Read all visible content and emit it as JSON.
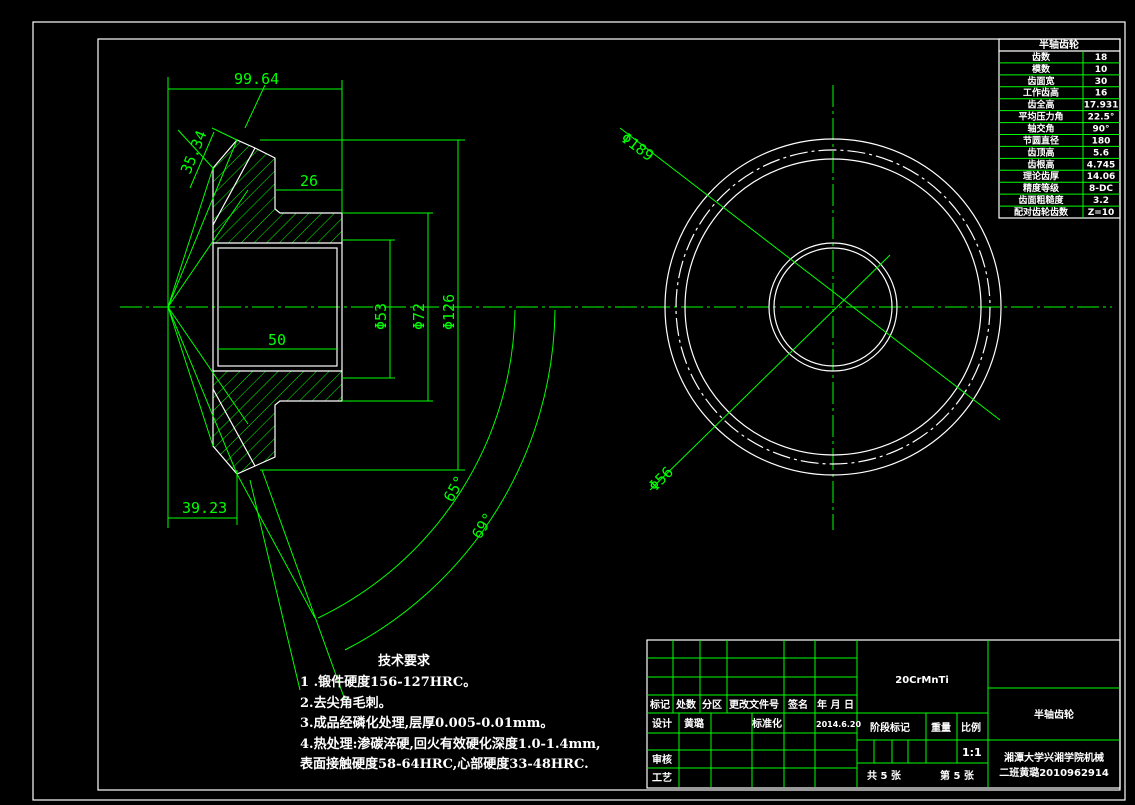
{
  "colors": {
    "background": "#000000",
    "outline": "#ffffff",
    "dimension": "#00ff00"
  },
  "dimensions": {
    "d1": "99.64",
    "d2": "35.34",
    "d3": "26",
    "d4": "50",
    "d5": "Φ53",
    "d6": "Φ72",
    "d7": "Φ126",
    "d8": "39.23",
    "d9": "65°",
    "d10": "69°",
    "d11": "Φ189",
    "d12": "Φ56"
  },
  "param_table": {
    "title": "半轴齿轮",
    "rows": [
      {
        "name": "齿数",
        "value": "18"
      },
      {
        "name": "模数",
        "value": "10"
      },
      {
        "name": "齿面宽",
        "value": "30"
      },
      {
        "name": "工作齿高",
        "value": "16"
      },
      {
        "name": "齿全高",
        "value": "17.931"
      },
      {
        "name": "平均压力角",
        "value": "22.5°"
      },
      {
        "name": "轴交角",
        "value": "90°"
      },
      {
        "name": "节圆直径",
        "value": "180"
      },
      {
        "name": "齿顶高",
        "value": "5.6"
      },
      {
        "name": "齿根高",
        "value": "4.745"
      },
      {
        "name": "理论齿厚",
        "value": "14.06"
      },
      {
        "name": "精度等级",
        "value": "8-DC"
      },
      {
        "name": "齿面粗糙度",
        "value": "3.2"
      },
      {
        "name": "配对齿轮齿数",
        "value": "Z=10"
      }
    ]
  },
  "tech_requirements": {
    "title": "技术要求",
    "lines": [
      "1 .锻件硬度156-127HRC。",
      "2.去尖角毛刺。",
      "3.成品经磷化处理,层厚0.005-0.01mm。",
      "4.热处理:渗碳淬硬,回火有效硬化深度1.0-1.4mm,",
      "表面接触硬度58-64HRC,心部硬度33-48HRC."
    ]
  },
  "title_block": {
    "header": [
      "标记",
      "处数",
      "分区",
      "更改文件号",
      "签名",
      "年 月 日"
    ],
    "design_label": "设计",
    "designer": "黄璐",
    "standard_label": "标准化",
    "date": "2014.6.20",
    "review_label": "审核",
    "process_label": "工艺",
    "material": "20CrMnTi",
    "stage_label": "阶段标记",
    "weight_label": "重量",
    "scale_label": "比例",
    "scale": "1:1",
    "sheets_total": "共 5 张",
    "sheet_no": "第 5 张",
    "part_name": "半轴齿轮",
    "org_line1": "湘潭大学兴湘学院机械",
    "org_line2": "二班黄璐2010962914"
  }
}
